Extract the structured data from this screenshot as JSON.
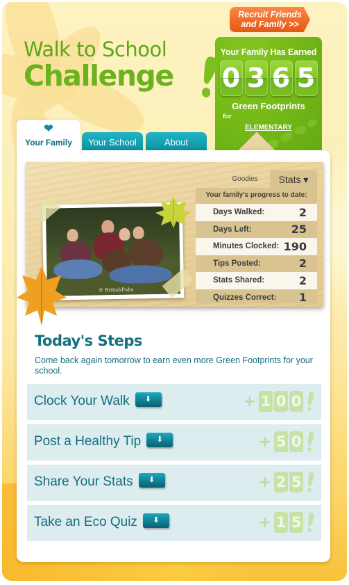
{
  "header": {
    "logo_line1": "Walk to School",
    "logo_line2": "Challenge",
    "recruit_button": "Recruit Friends and Family >>"
  },
  "earned": {
    "title": "Your Family Has Earned",
    "digits": [
      "0",
      "3",
      "6",
      "5"
    ],
    "total": 365,
    "unit": "Green Footprints",
    "for_label": "for",
    "school": "ELEMENTARY"
  },
  "tabs": [
    {
      "label": "Your Family",
      "active": true,
      "icon": "heart-icon"
    },
    {
      "label": "Your School",
      "active": false
    },
    {
      "label": "About",
      "active": false
    }
  ],
  "photo": {
    "caption": "© BritishPubs"
  },
  "stats": {
    "tabs": [
      {
        "label": "Goodies",
        "active": false
      },
      {
        "label": "Stats ▾",
        "active": true
      }
    ],
    "heading": "Your family's progress to date:",
    "rows": [
      {
        "label": "Days Walked:",
        "value": "2"
      },
      {
        "label": "Days Left:",
        "value": "25"
      },
      {
        "label": "Minutes Clocked:",
        "value": "190"
      },
      {
        "label": "Tips Posted:",
        "value": "2"
      },
      {
        "label": "Stats Shared:",
        "value": "2"
      },
      {
        "label": "Quizzes Correct:",
        "value": "1"
      }
    ]
  },
  "steps": {
    "title": "Today's Steps",
    "description": "Come back again tomorrow to earn even more Green Footprints for your school.",
    "items": [
      {
        "label": "Clock Your Walk",
        "points_plus": "+",
        "points": [
          "1",
          "0",
          "0"
        ]
      },
      {
        "label": "Post a Healthy Tip",
        "points_plus": "+",
        "points": [
          "5",
          "0"
        ]
      },
      {
        "label": "Share Your Stats",
        "points_plus": "+",
        "points": [
          "2",
          "5"
        ]
      },
      {
        "label": "Take an Eco Quiz",
        "points_plus": "+",
        "points": [
          "1",
          "5"
        ]
      }
    ],
    "expand_glyph": "⬇"
  },
  "colors": {
    "brand_green": "#6cb11e",
    "teal": "#126f80",
    "orange": "#ef6a25"
  }
}
